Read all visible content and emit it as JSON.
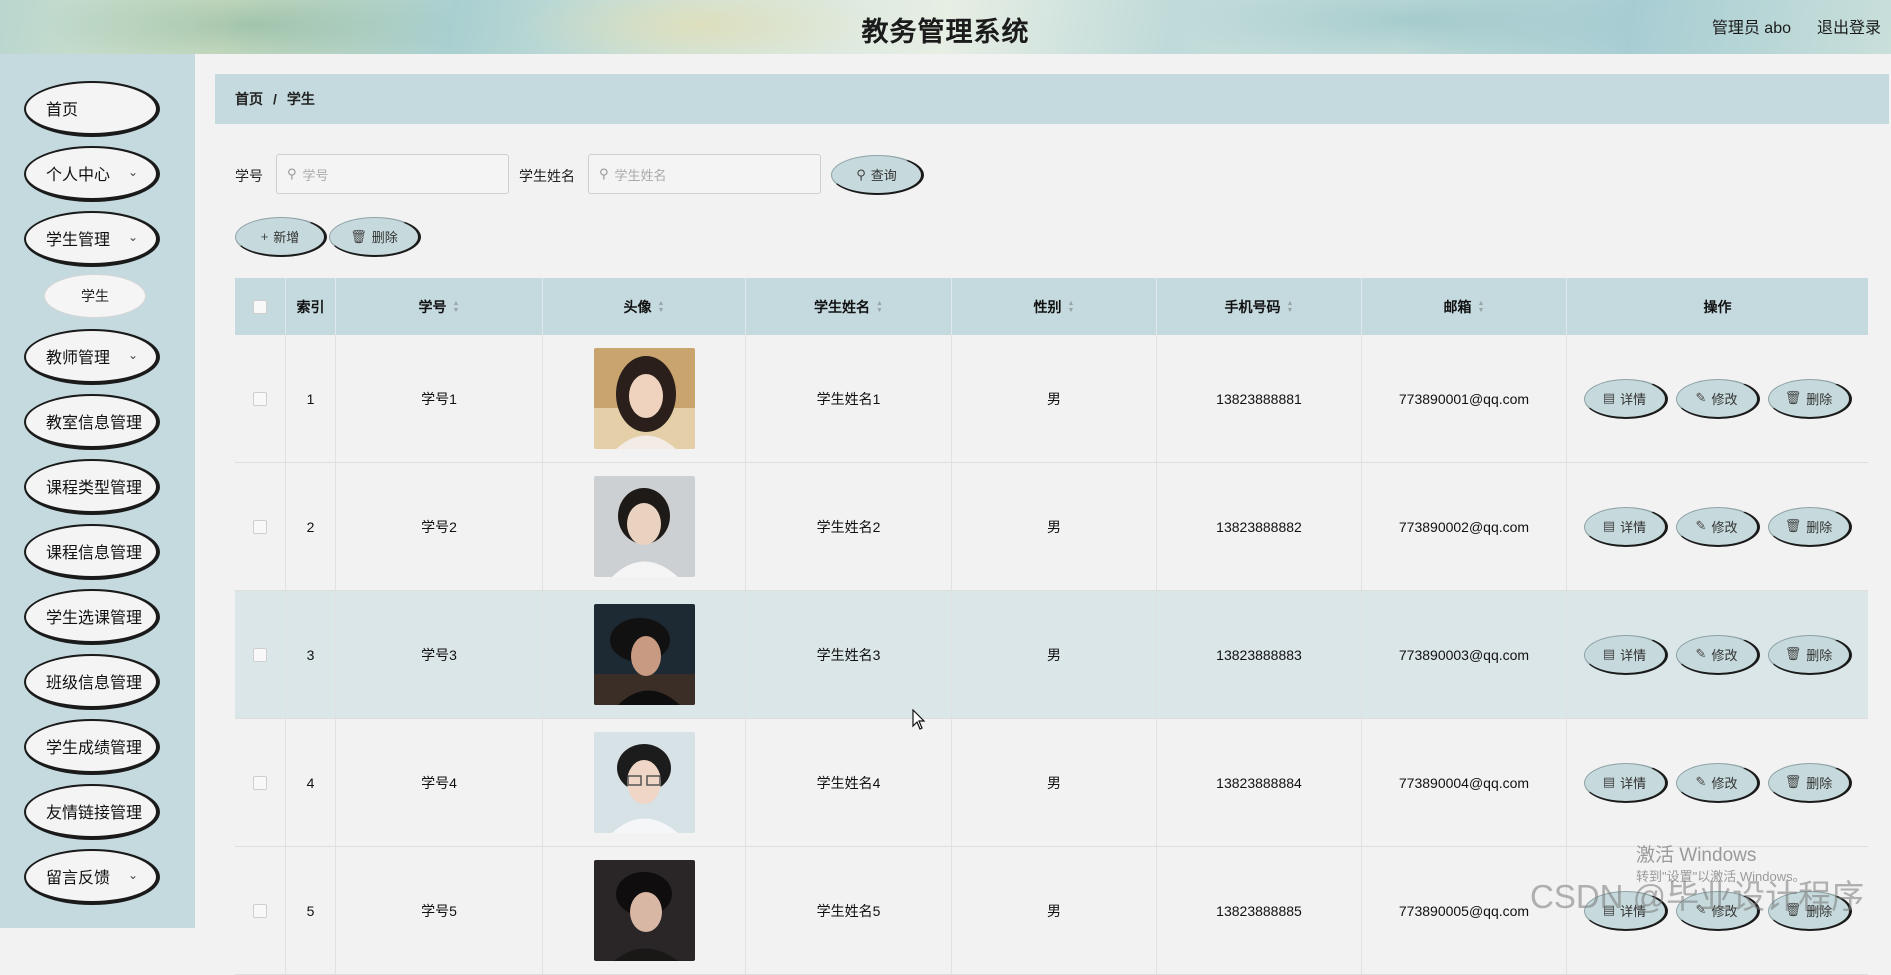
{
  "header": {
    "title": "教务管理系统",
    "user_label": "管理员 abo",
    "logout_label": "退出登录"
  },
  "sidebar": {
    "items": [
      {
        "label": "首页",
        "has_submenu": false
      },
      {
        "label": "个人中心",
        "has_submenu": true
      },
      {
        "label": "学生管理",
        "has_submenu": true
      },
      {
        "label": "教师管理",
        "has_submenu": true
      },
      {
        "label": "教室信息管理",
        "has_submenu": false
      },
      {
        "label": "课程类型管理",
        "has_submenu": false
      },
      {
        "label": "课程信息管理",
        "has_submenu": false
      },
      {
        "label": "学生选课管理",
        "has_submenu": false
      },
      {
        "label": "班级信息管理",
        "has_submenu": false
      },
      {
        "label": "学生成绩管理",
        "has_submenu": false
      },
      {
        "label": "友情链接管理",
        "has_submenu": false
      },
      {
        "label": "留言反馈",
        "has_submenu": true
      }
    ],
    "sub_item": {
      "label": "学生"
    }
  },
  "breadcrumb": {
    "home": "首页",
    "separator": "/",
    "current": "学生"
  },
  "search": {
    "student_id_label": "学号",
    "student_id_placeholder": "学号",
    "student_name_label": "学生姓名",
    "student_name_placeholder": "学生姓名",
    "query_button": "查询"
  },
  "actions": {
    "add_button": "新增",
    "delete_button": "删除"
  },
  "table": {
    "columns": [
      "索引",
      "学号",
      "头像",
      "学生姓名",
      "性别",
      "手机号码",
      "邮箱",
      "操作"
    ],
    "row_actions": {
      "detail": "详情",
      "edit": "修改",
      "delete": "删除"
    },
    "rows": [
      {
        "index": "1",
        "student_id": "学号1",
        "name": "学生姓名1",
        "gender": "男",
        "phone": "13823888881",
        "email": "773890001@qq.com"
      },
      {
        "index": "2",
        "student_id": "学号2",
        "name": "学生姓名2",
        "gender": "男",
        "phone": "13823888882",
        "email": "773890002@qq.com"
      },
      {
        "index": "3",
        "student_id": "学号3",
        "name": "学生姓名3",
        "gender": "男",
        "phone": "13823888883",
        "email": "773890003@qq.com"
      },
      {
        "index": "4",
        "student_id": "学号4",
        "name": "学生姓名4",
        "gender": "男",
        "phone": "13823888884",
        "email": "773890004@qq.com"
      },
      {
        "index": "5",
        "student_id": "学号5",
        "name": "学生姓名5",
        "gender": "男",
        "phone": "13823888885",
        "email": "773890005@qq.com"
      }
    ]
  },
  "overlay": {
    "activate_windows": "激活 Windows",
    "activate_windows_hint": "转到\"设置\"以激活 Windows。",
    "watermark": "CSDN @毕业设计程序"
  },
  "colors": {
    "accent": "#c5dade",
    "row_highlight": "#dbe6e8",
    "background": "#f2f2f2"
  }
}
